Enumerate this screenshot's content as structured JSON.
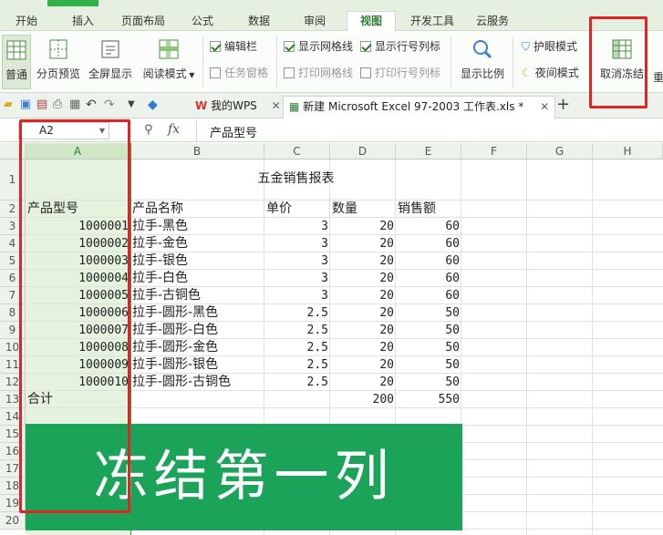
{
  "menu": {
    "tabs": [
      "开始",
      "插入",
      "页面布局",
      "公式",
      "数据",
      "审阅",
      "视图",
      "开发工具",
      "云服务"
    ],
    "active_tab": "视图"
  },
  "ribbon": {
    "normal": "普通",
    "page_break_preview": "分页预览",
    "full_screen": "全屏显示",
    "reading_mode": "阅读模式",
    "checks": {
      "edit_bar": "编辑栏",
      "task_pane": "任务窗格",
      "show_gridlines": "显示网格线",
      "print_gridlines": "打印网格线",
      "show_row_col_labels": "显示行号列标",
      "print_row_col_labels": "打印行号列标"
    },
    "zoom": "显示比例",
    "eye_protection": "护眼模式",
    "night_mode": "夜间模式",
    "unfreeze": "取消冻结",
    "rearrange": "重"
  },
  "doc_tabs": {
    "mywps": "我的WPS",
    "file": "新建 Microsoft Excel 97-2003 工作表.xls *"
  },
  "formula_bar": {
    "name_box": "A2",
    "fx": "fx",
    "content": "产品型号"
  },
  "sheet": {
    "columns": [
      "A",
      "B",
      "C",
      "D",
      "E",
      "F",
      "G",
      "H"
    ],
    "rows": [
      "1",
      "2",
      "3",
      "4",
      "5",
      "6",
      "7",
      "8",
      "9",
      "10",
      "11",
      "12",
      "13",
      "14",
      "15",
      "16",
      "17",
      "18",
      "19",
      "20"
    ],
    "title": "五金销售报表",
    "headers": [
      "产品型号",
      "产品名称",
      "单价",
      "数量",
      "销售额"
    ],
    "data": [
      [
        "1000001",
        "拉手-黑色",
        "3",
        "20",
        "60"
      ],
      [
        "1000002",
        "拉手-金色",
        "3",
        "20",
        "60"
      ],
      [
        "1000003",
        "拉手-银色",
        "3",
        "20",
        "60"
      ],
      [
        "1000004",
        "拉手-白色",
        "3",
        "20",
        "60"
      ],
      [
        "1000005",
        "拉手-古铜色",
        "3",
        "20",
        "60"
      ],
      [
        "1000006",
        "拉手-圆形-黑色",
        "2.5",
        "20",
        "50"
      ],
      [
        "1000007",
        "拉手-圆形-白色",
        "2.5",
        "20",
        "50"
      ],
      [
        "1000008",
        "拉手-圆形-金色",
        "2.5",
        "20",
        "50"
      ],
      [
        "1000009",
        "拉手-圆形-银色",
        "2.5",
        "20",
        "50"
      ],
      [
        "1000010",
        "拉手-圆形-古铜色",
        "2.5",
        "20",
        "50"
      ]
    ],
    "total_label": "合计",
    "total_qty": "200",
    "total_sales": "550"
  },
  "banner_text": "冻结第一列",
  "colors": {
    "accent": "#2e7d32",
    "banner": "#1ba35a",
    "highlight": "#e02424"
  }
}
